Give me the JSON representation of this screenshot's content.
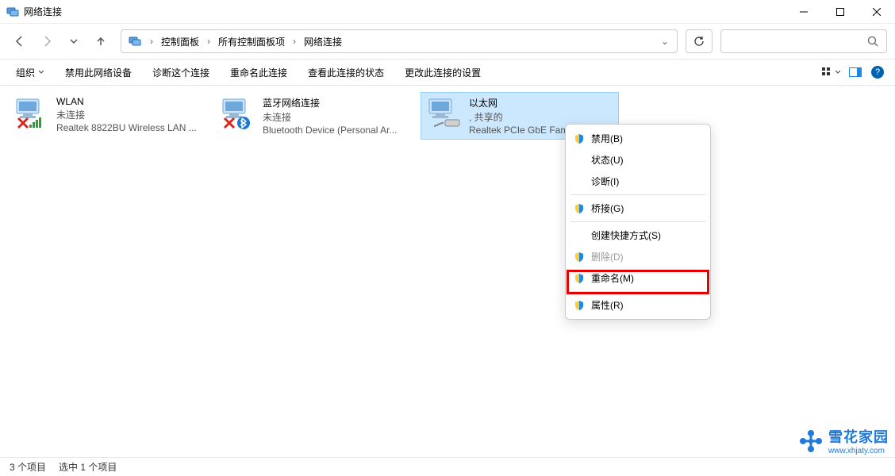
{
  "window": {
    "title": "网络连接"
  },
  "breadcrumb": {
    "item1": "控制面板",
    "item2": "所有控制面板项",
    "item3": "网络连接"
  },
  "toolbar": {
    "organize": "组织",
    "disable": "禁用此网络设备",
    "diagnose": "诊断这个连接",
    "rename": "重命名此连接",
    "viewstatus": "查看此连接的状态",
    "changesettings": "更改此连接的设置"
  },
  "adapters": [
    {
      "name": "WLAN",
      "status": "未连接",
      "device": "Realtek 8822BU Wireless LAN ..."
    },
    {
      "name": "蓝牙网络连接",
      "status": "未连接",
      "device": "Bluetooth Device (Personal Ar..."
    },
    {
      "name": "以太网",
      "status": ", 共享的",
      "device": "Realtek PCIe GbE Famil..."
    }
  ],
  "contextmenu": {
    "disable": "禁用(B)",
    "status": "状态(U)",
    "diagnose": "诊断(I)",
    "bridge": "桥接(G)",
    "shortcut": "创建快捷方式(S)",
    "delete": "删除(D)",
    "rename": "重命名(M)",
    "properties": "属性(R)"
  },
  "statusbar": {
    "count": "3 个项目",
    "selected": "选中 1 个项目"
  },
  "watermark": {
    "text1": "雪花家园",
    "text2": "www.xhjaty.com"
  }
}
